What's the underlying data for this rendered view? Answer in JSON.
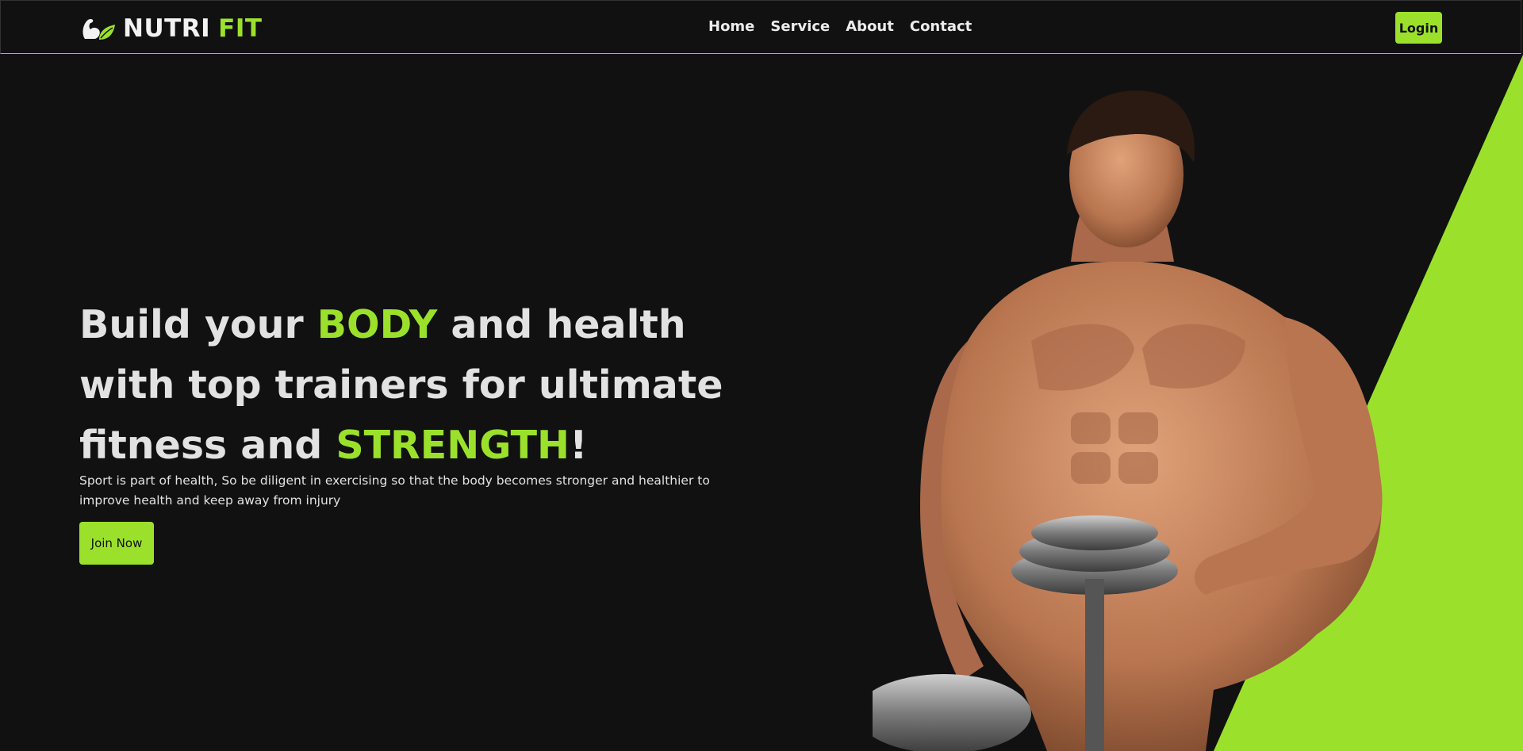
{
  "brand": {
    "name": "NUTRI",
    "accent": "FIT",
    "icon": "flexed-arm-leaf-icon"
  },
  "nav": {
    "items": [
      {
        "label": "Home"
      },
      {
        "label": "Service"
      },
      {
        "label": "About"
      },
      {
        "label": "Contact"
      }
    ]
  },
  "header": {
    "login_label": "Login"
  },
  "hero": {
    "title_part1": "Build your ",
    "title_accent1": "BODY",
    "title_part2": " and health with top trainers for ultimate fitness and ",
    "title_accent2": "STRENGTH",
    "title_part3": "!",
    "description": "Sport is part of health, So be diligent in exercising so that the body becomes stronger and healthier to improve health and keep away from injury",
    "cta_label": "Join Now"
  },
  "colors": {
    "accent": "#9be12b",
    "background": "#111112",
    "text": "#e2e2e2"
  }
}
